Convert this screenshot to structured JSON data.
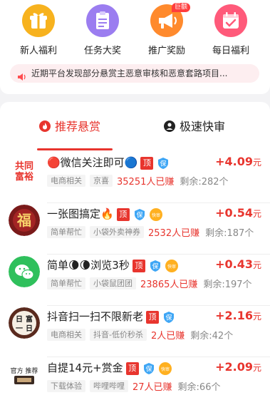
{
  "features": [
    {
      "label": "新人福利",
      "icon": "gift-icon",
      "color": "#f7b21e"
    },
    {
      "label": "任务大奖",
      "icon": "clipboard-icon",
      "color": "#9b7df0"
    },
    {
      "label": "推广奖励",
      "icon": "megaphone-icon",
      "color": "#ff8a2d",
      "badge": "巨额"
    },
    {
      "label": "每日福利",
      "icon": "calendar-check-icon",
      "color": "#ff5a7a"
    }
  ],
  "notice": {
    "text": "近期平台发现部分悬赏主恶意审核和恶意套路项目..."
  },
  "tabs": [
    {
      "label": "推荐悬赏",
      "icon": "fire-icon",
      "active": true
    },
    {
      "label": "极速快审",
      "icon": "user-circle-icon",
      "active": false
    }
  ],
  "tasks": [
    {
      "avatar_text": "共同富裕",
      "title": "🔴微信关注即可🔵",
      "badges": [
        "顶",
        "保"
      ],
      "price": "+4.09",
      "unit": "元",
      "tags": [
        "电商相关",
        "京喜"
      ],
      "earned": "35251人已赚",
      "remaining": "剩余:282个"
    },
    {
      "avatar_text": "福",
      "title": "一张图搞定🔥",
      "badges": [
        "顶",
        "保",
        "快审"
      ],
      "price": "+0.54",
      "unit": "元",
      "tags": [
        "简单帮忙",
        "小袋外卖神券"
      ],
      "earned": "2532人已赚",
      "remaining": "剩余:187个"
    },
    {
      "avatar_text": "",
      "title": "简单🌘🌘浏览3秒",
      "badges": [
        "顶",
        "保",
        "快审"
      ],
      "price": "+0.43",
      "unit": "元",
      "tags": [
        "简单帮忙",
        "小袋鼠团团"
      ],
      "earned": "23865人已赚",
      "remaining": "剩余:197个"
    },
    {
      "avatar_text": "日富一日",
      "title": "抖音扫一扫不限新老",
      "badges": [
        "顶",
        "保"
      ],
      "price": "+2.16",
      "unit": "元",
      "tags": [
        "电商相关",
        "抖音-低价秒杀"
      ],
      "earned": "2人已赚",
      "remaining": "剩余:42个"
    },
    {
      "avatar_text": "官方推荐",
      "title": "自提14元+赏金",
      "badges": [
        "顶",
        "保",
        "快审"
      ],
      "price": "+2.09",
      "unit": "元",
      "tags": [
        "下载体验",
        "哔哩哔哩"
      ],
      "earned": "27人已赚",
      "remaining": "剩余:66个"
    }
  ]
}
